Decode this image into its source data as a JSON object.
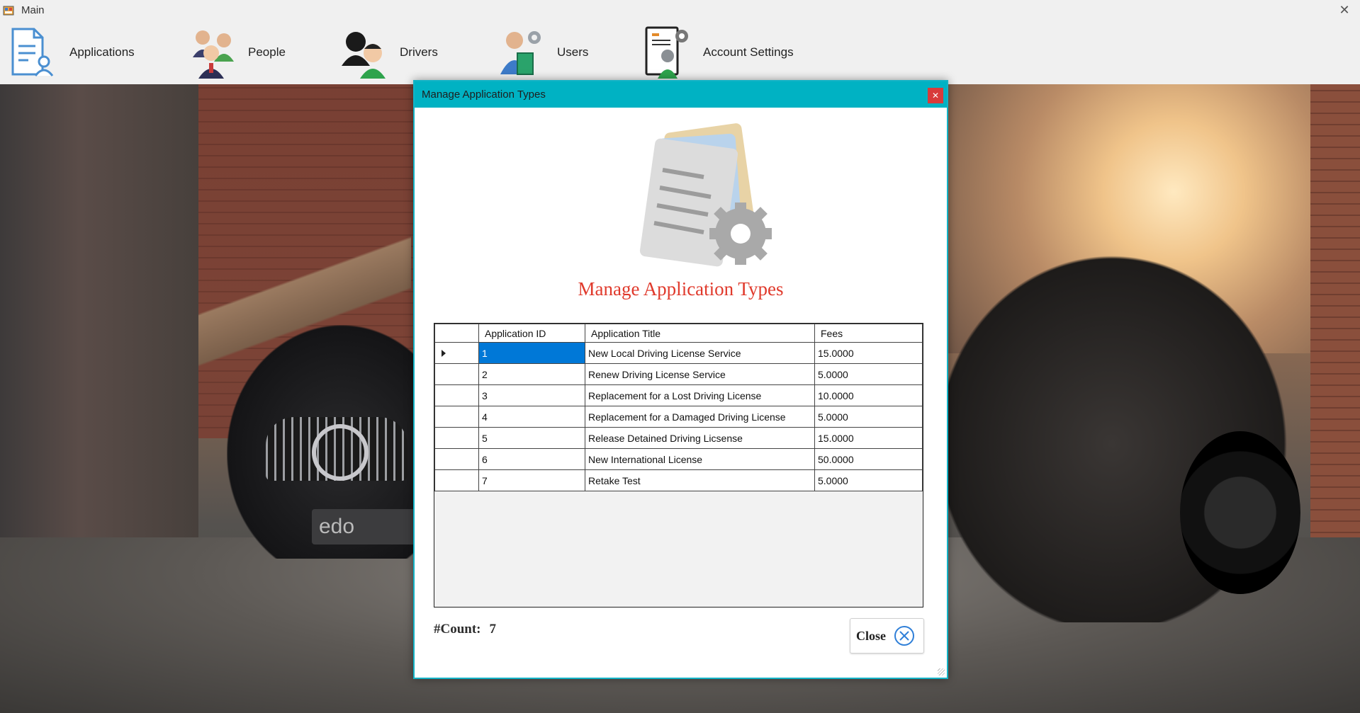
{
  "window": {
    "title": "Main"
  },
  "menu": {
    "items": [
      {
        "label": "Applications",
        "icon": "applications-icon"
      },
      {
        "label": "People",
        "icon": "people-icon"
      },
      {
        "label": "Drivers",
        "icon": "drivers-icon"
      },
      {
        "label": "Users",
        "icon": "users-icon"
      },
      {
        "label": "Account Settings",
        "icon": "account-settings-icon"
      }
    ]
  },
  "background": {
    "plate_text": "edo"
  },
  "dialog": {
    "title": "Manage Application Types",
    "heading": "Manage Application Types",
    "accent_color": "#00b2c3",
    "heading_color": "#e03a2c",
    "grid": {
      "columns": [
        "Application ID",
        "Application Title",
        "Fees"
      ],
      "rows": [
        {
          "id": "1",
          "title": "New Local Driving License Service",
          "fees": "15.0000"
        },
        {
          "id": "2",
          "title": "Renew Driving License Service",
          "fees": "5.0000"
        },
        {
          "id": "3",
          "title": "Replacement for a Lost Driving License",
          "fees": "10.0000"
        },
        {
          "id": "4",
          "title": "Replacement for a Damaged Driving License",
          "fees": "5.0000"
        },
        {
          "id": "5",
          "title": "Release Detained Driving Licsense",
          "fees": "15.0000"
        },
        {
          "id": "6",
          "title": "New International License",
          "fees": "50.0000"
        },
        {
          "id": "7",
          "title": "Retake Test",
          "fees": "5.0000"
        }
      ],
      "selected_color": "#0078d7"
    },
    "count_label": "#Count:",
    "count_value": "7",
    "close_label": "Close"
  }
}
